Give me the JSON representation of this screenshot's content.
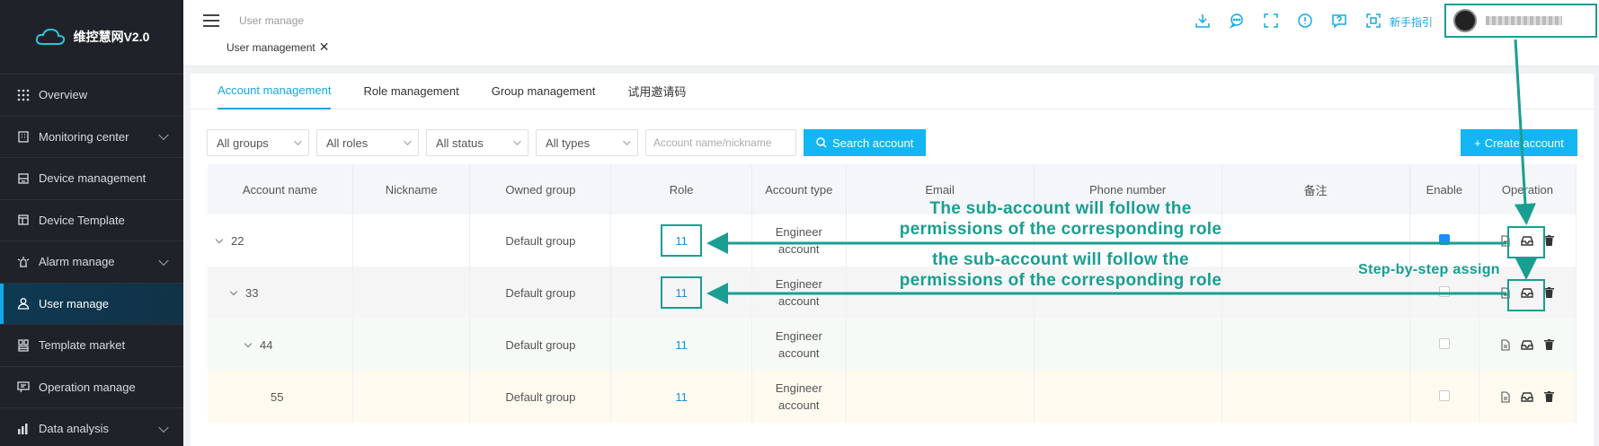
{
  "app": {
    "name": "维控慧网V2.0"
  },
  "sidebar": {
    "items": [
      {
        "label": "Overview",
        "icon": "grid-icon",
        "has_children": false,
        "active": false
      },
      {
        "label": "Monitoring center",
        "icon": "building-icon",
        "has_children": true,
        "active": false
      },
      {
        "label": "Device management",
        "icon": "device-icon",
        "has_children": false,
        "active": false
      },
      {
        "label": "Device Template",
        "icon": "template-icon",
        "has_children": false,
        "active": false
      },
      {
        "label": "Alarm manage",
        "icon": "alarm-icon",
        "has_children": true,
        "active": false
      },
      {
        "label": "User manage",
        "icon": "user-icon",
        "has_children": false,
        "active": true
      },
      {
        "label": "Template market",
        "icon": "market-icon",
        "has_children": false,
        "active": false
      },
      {
        "label": "Operation manage",
        "icon": "operation-icon",
        "has_children": false,
        "active": false
      },
      {
        "label": "Data analysis",
        "icon": "chart-icon",
        "has_children": true,
        "active": false
      }
    ]
  },
  "header": {
    "breadcrumb": "User manage",
    "open_tab": "User management",
    "guide": "新手指引",
    "icons": [
      "download-icon",
      "message-icon",
      "fullscreen-icon",
      "info-icon",
      "help-icon",
      "scan-icon"
    ]
  },
  "tabs": [
    "Account management",
    "Role management",
    "Group management",
    "试用邀请码"
  ],
  "filters": {
    "groups": "All groups",
    "roles": "All roles",
    "status": "All status",
    "types": "All types",
    "search_placeholder": "Account name/nickname",
    "search_button": "Search account",
    "create_button": "Create account"
  },
  "table": {
    "columns": [
      "Account name",
      "Nickname",
      "Owned group",
      "Role",
      "Account type",
      "Email",
      "Phone number",
      "备注",
      "Enable",
      "Operation"
    ],
    "rows": [
      {
        "name": "22",
        "nickname": "",
        "group": "Default group",
        "role": "11",
        "type": "Engineer account",
        "email": "",
        "phone": "",
        "remark": "",
        "enabled": true
      },
      {
        "name": "33",
        "nickname": "",
        "group": "Default group",
        "role": "11",
        "type": "Engineer account",
        "email": "",
        "phone": "",
        "remark": "",
        "enabled": true
      },
      {
        "name": "44",
        "nickname": "",
        "group": "Default group",
        "role": "11",
        "type": "Engineer account",
        "email": "",
        "phone": "",
        "remark": "",
        "enabled": true
      },
      {
        "name": "55",
        "nickname": "",
        "group": "Default group",
        "role": "11",
        "type": "Engineer account",
        "email": "",
        "phone": "",
        "remark": "",
        "enabled": true
      }
    ]
  },
  "annotations": {
    "note1_line1": "The sub-account will follow the",
    "note1_line2": "permissions of the corresponding role",
    "note2_line1": "the sub-account will follow the",
    "note2_line2": "permissions of the corresponding role",
    "note3": "Step-by-step assign"
  },
  "colors": {
    "accent": "#13b6f2",
    "annotation": "#1a9e92",
    "sidebar_bg": "#1f2329"
  }
}
